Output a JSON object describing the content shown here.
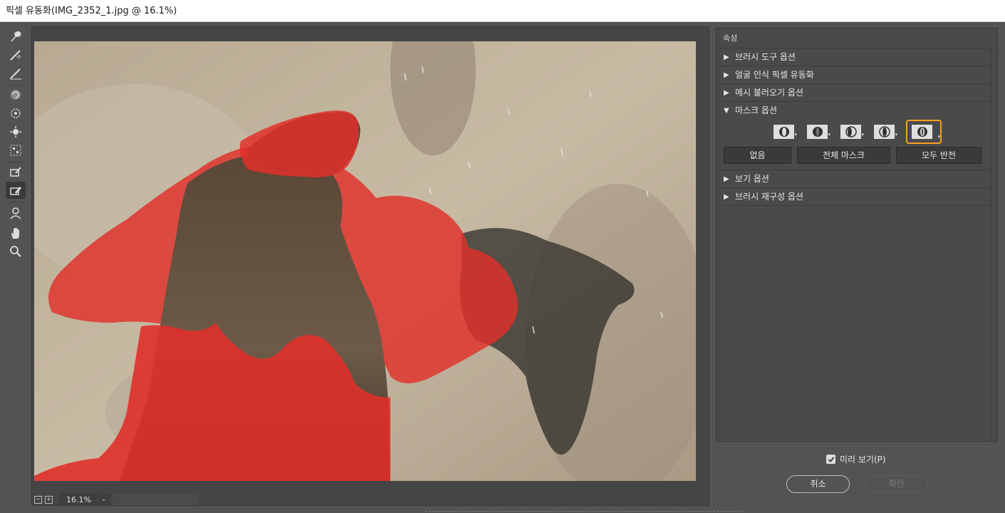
{
  "window": {
    "title": "픽셀 유동화(IMG_2352_1.jpg @ 16.1%)"
  },
  "tools": [
    {
      "name": "forward-warp-icon"
    },
    {
      "name": "reconstruct-icon"
    },
    {
      "name": "smooth-icon"
    },
    {
      "name": "twirl-icon"
    },
    {
      "name": "pucker-icon"
    },
    {
      "name": "bloat-icon"
    },
    {
      "name": "push-left-icon"
    },
    {
      "name": "freeze-mask-icon"
    },
    {
      "name": "thaw-mask-icon"
    },
    {
      "name": "face-tool-icon"
    },
    {
      "name": "hand-icon"
    },
    {
      "name": "zoom-icon"
    }
  ],
  "status": {
    "zoom": "16.1%"
  },
  "panel": {
    "header": "속성",
    "sections": {
      "brush_tool": "브러시 도구 옵션",
      "face_aware": "얼굴 인식 픽셀 유동화",
      "load_mesh": "메시 불러오기 옵션",
      "mask": "마스크 옵션",
      "view": "보기 옵션",
      "brush_reconstruct": "브러시 재구성 옵션"
    },
    "mask_modes": [
      "replace-selection-icon",
      "add-to-selection-icon",
      "subtract-from-selection-icon",
      "intersect-with-selection-icon",
      "invert-selection-icon"
    ],
    "mask_buttons": {
      "none": "없음",
      "mask_all": "전체 마스크",
      "invert_all": "모두 반전"
    }
  },
  "footer": {
    "preview_label": "미리 보기(P)",
    "preview_checked": true,
    "cancel": "취소",
    "ok": "확인"
  },
  "colors": {
    "accent": "#f3a11b",
    "mask": "#e0302a",
    "ui_bg": "#535353"
  }
}
